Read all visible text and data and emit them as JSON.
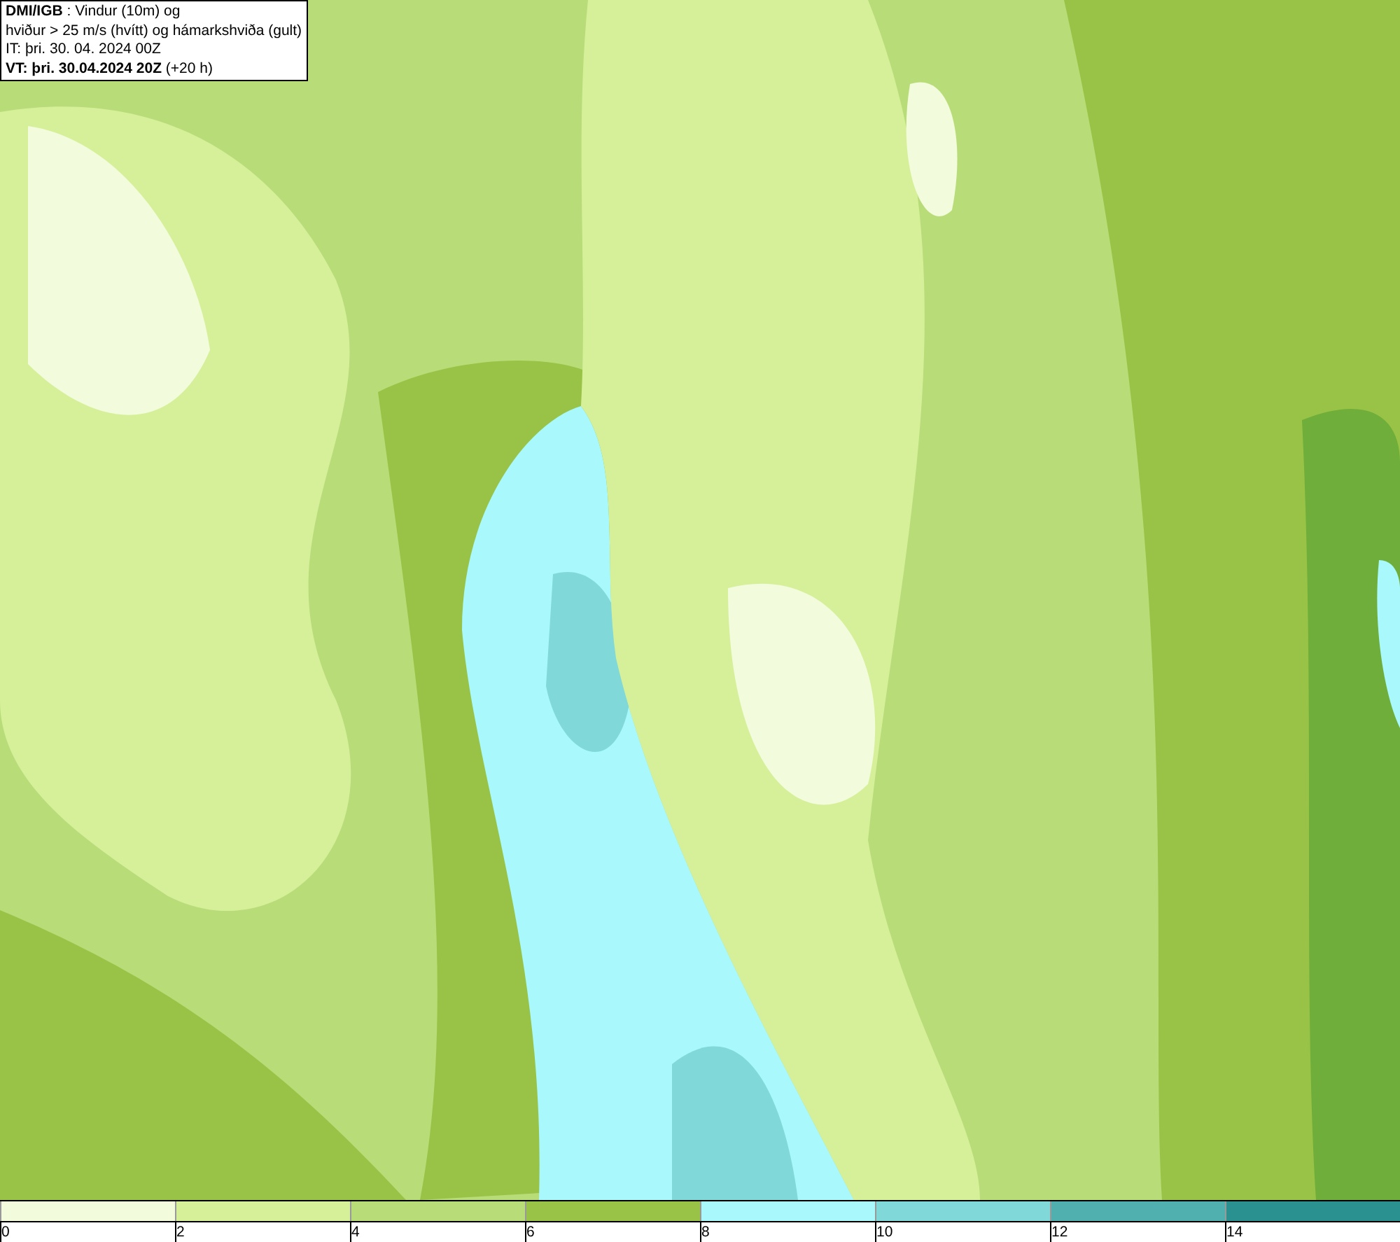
{
  "info_box": {
    "lines": [
      "**DMI/IGB** : Vindur (10m) og",
      "hviður > 25 m/s (hvítt) og hámarkshviða (gult)",
      "IT: þri. 30. 04. 2024 00Z",
      "**VT: þri. 30.04.2024 20Z** (+20 h)"
    ]
  },
  "legend": [
    {
      "label": "0",
      "color": "#f2fbdc"
    },
    {
      "label": "2",
      "color": "#d6f09a"
    },
    {
      "label": "4",
      "color": "#b8dc78"
    },
    {
      "label": "6",
      "color": "#98c346"
    },
    {
      "label": "8",
      "color": "#a8f8fc"
    },
    {
      "label": "10",
      "color": "#80d8d8"
    },
    {
      "label": "12",
      "color": "#50b0b0"
    },
    {
      "label": "14",
      "color": "#2a9090"
    }
  ]
}
